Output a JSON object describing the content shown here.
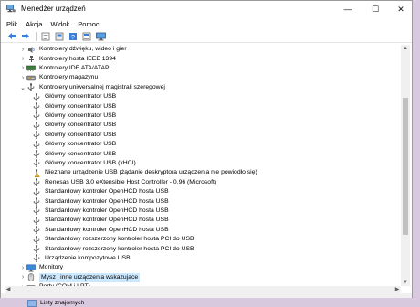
{
  "window": {
    "title": "Menedżer urządzeń",
    "controls": {
      "minimize": "—",
      "maximize": "☐",
      "close": "✕"
    }
  },
  "menu": [
    "Plik",
    "Akcja",
    "Widok",
    "Pomoc"
  ],
  "toolbar": [
    "back-icon",
    "forward-icon",
    "properties-icon",
    "view-icon",
    "help-icon",
    "view-list-icon",
    "monitor-icon"
  ],
  "tree": [
    {
      "level": 0,
      "expander": "collapsed",
      "icon": "audio-icon",
      "label": "Kontrolery dźwięku, wideo i gier"
    },
    {
      "level": 0,
      "expander": "collapsed",
      "icon": "firewire-icon",
      "label": "Kontrolery hosta IEEE 1394"
    },
    {
      "level": 0,
      "expander": "collapsed",
      "icon": "ide-icon",
      "label": "Kontrolery IDE ATA/ATAPI"
    },
    {
      "level": 0,
      "expander": "collapsed",
      "icon": "storage-icon",
      "label": "Kontrolery magazynu"
    },
    {
      "level": 0,
      "expander": "expanded",
      "icon": "usb-icon",
      "label": "Kontrolery uniwersalnej magistrali szeregowej"
    },
    {
      "level": 1,
      "icon": "usb-icon",
      "label": "Główny koncentrator USB"
    },
    {
      "level": 1,
      "icon": "usb-icon",
      "label": "Główny koncentrator USB"
    },
    {
      "level": 1,
      "icon": "usb-icon",
      "label": "Główny koncentrator USB"
    },
    {
      "level": 1,
      "icon": "usb-icon",
      "label": "Główny koncentrator USB"
    },
    {
      "level": 1,
      "icon": "usb-icon",
      "label": "Główny koncentrator USB"
    },
    {
      "level": 1,
      "icon": "usb-icon",
      "label": "Główny koncentrator USB"
    },
    {
      "level": 1,
      "icon": "usb-icon",
      "label": "Główny koncentrator USB"
    },
    {
      "level": 1,
      "icon": "usb-icon",
      "label": "Główny koncentrator USB (xHCI)"
    },
    {
      "level": 1,
      "icon": "usb-warning-icon",
      "label": "Nieznane urządzenie USB (żądanie deskryptora urządzenia nie powiodło się)"
    },
    {
      "level": 1,
      "icon": "usb-icon",
      "label": "Renesas USB 3.0 eXtensible Host Controller - 0.96 (Microsoft)"
    },
    {
      "level": 1,
      "icon": "usb-icon",
      "label": "Standardowy kontroler OpenHCD hosta USB"
    },
    {
      "level": 1,
      "icon": "usb-icon",
      "label": "Standardowy kontroler OpenHCD hosta USB"
    },
    {
      "level": 1,
      "icon": "usb-icon",
      "label": "Standardowy kontroler OpenHCD hosta USB"
    },
    {
      "level": 1,
      "icon": "usb-icon",
      "label": "Standardowy kontroler OpenHCD hosta USB"
    },
    {
      "level": 1,
      "icon": "usb-icon",
      "label": "Standardowy kontroler OpenHCD hosta USB"
    },
    {
      "level": 1,
      "icon": "usb-icon",
      "label": "Standardowy rozszerzony kontroler hosta PCI do USB"
    },
    {
      "level": 1,
      "icon": "usb-icon",
      "label": "Standardowy rozszerzony kontroler hosta PCI do USB"
    },
    {
      "level": 1,
      "icon": "usb-icon",
      "label": "Urządzenie kompozytowe USB"
    },
    {
      "level": 0,
      "expander": "collapsed",
      "icon": "monitor-icon",
      "label": "Monitory"
    },
    {
      "level": 0,
      "expander": "collapsed",
      "icon": "mouse-icon",
      "label": "Mysz i inne urządzenia wskazujące",
      "selected": true
    },
    {
      "level": 0,
      "expander": "collapsed",
      "icon": "port-icon",
      "label": "Porty (COM i LPT)"
    }
  ],
  "background": {
    "label": "Listy znajomych"
  },
  "colors": {
    "selection": "#cce8ff",
    "accent": "#0078d7",
    "warning": "#f3b300"
  }
}
